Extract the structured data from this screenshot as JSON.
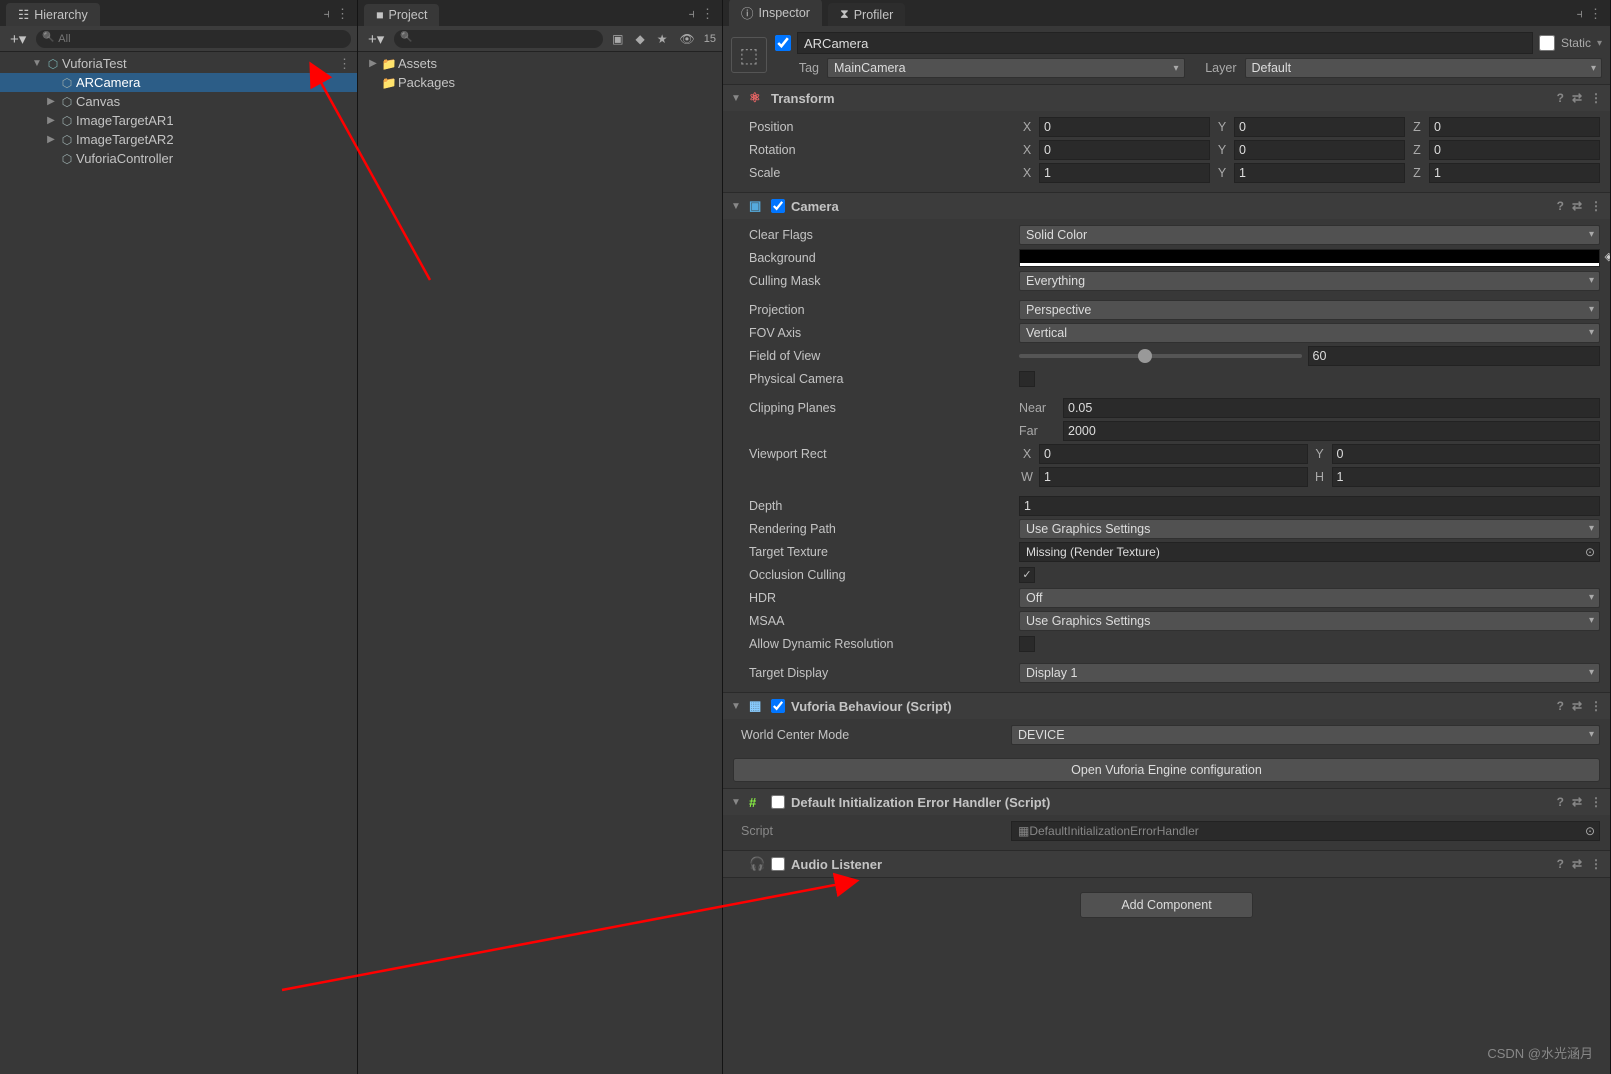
{
  "hierarchy": {
    "tab": "Hierarchy",
    "search_placeholder": "All",
    "scene": "VuforiaTest",
    "items": [
      {
        "label": "ARCamera",
        "selected": true
      },
      {
        "label": "Canvas"
      },
      {
        "label": "ImageTargetAR1"
      },
      {
        "label": "ImageTargetAR2"
      },
      {
        "label": "VuforiaController"
      }
    ]
  },
  "project": {
    "tab": "Project",
    "hidden_count": "15",
    "items": [
      {
        "label": "Assets"
      },
      {
        "label": "Packages"
      }
    ]
  },
  "inspector": {
    "tab": "Inspector",
    "tab2": "Profiler",
    "go_name": "ARCamera",
    "static_label": "Static",
    "tag_label": "Tag",
    "tag_value": "MainCamera",
    "layer_label": "Layer",
    "layer_value": "Default",
    "transform": {
      "title": "Transform",
      "position": {
        "label": "Position",
        "x": "0",
        "y": "0",
        "z": "0"
      },
      "rotation": {
        "label": "Rotation",
        "x": "0",
        "y": "0",
        "z": "0"
      },
      "scale": {
        "label": "Scale",
        "x": "1",
        "y": "1",
        "z": "1"
      }
    },
    "camera": {
      "title": "Camera",
      "clear_flags": {
        "label": "Clear Flags",
        "value": "Solid Color"
      },
      "background": {
        "label": "Background"
      },
      "culling_mask": {
        "label": "Culling Mask",
        "value": "Everything"
      },
      "projection": {
        "label": "Projection",
        "value": "Perspective"
      },
      "fov_axis": {
        "label": "FOV Axis",
        "value": "Vertical"
      },
      "fov": {
        "label": "Field of View",
        "value": "60"
      },
      "phys_cam": {
        "label": "Physical Camera"
      },
      "clip": {
        "label": "Clipping Planes",
        "near_l": "Near",
        "near": "0.05",
        "far_l": "Far",
        "far": "2000"
      },
      "viewport": {
        "label": "Viewport Rect",
        "x": "0",
        "y": "0",
        "w": "1",
        "h": "1"
      },
      "depth": {
        "label": "Depth",
        "value": "1"
      },
      "rendering_path": {
        "label": "Rendering Path",
        "value": "Use Graphics Settings"
      },
      "target_texture": {
        "label": "Target Texture",
        "value": "Missing (Render Texture)"
      },
      "occlusion": {
        "label": "Occlusion Culling"
      },
      "hdr": {
        "label": "HDR",
        "value": "Off"
      },
      "msaa": {
        "label": "MSAA",
        "value": "Use Graphics Settings"
      },
      "allow_dyn": {
        "label": "Allow Dynamic Resolution"
      },
      "target_display": {
        "label": "Target Display",
        "value": "Display 1"
      }
    },
    "vuforia": {
      "title": "Vuforia Behaviour (Script)",
      "wcm": {
        "label": "World Center Mode",
        "value": "DEVICE"
      },
      "open_config": "Open Vuforia Engine configuration"
    },
    "default_init": {
      "title": "Default Initialization Error Handler (Script)",
      "script_label": "Script",
      "script_value": "DefaultInitializationErrorHandler"
    },
    "audio": {
      "title": "Audio Listener"
    },
    "add_component": "Add Component"
  },
  "watermark": "CSDN @水光涵月"
}
